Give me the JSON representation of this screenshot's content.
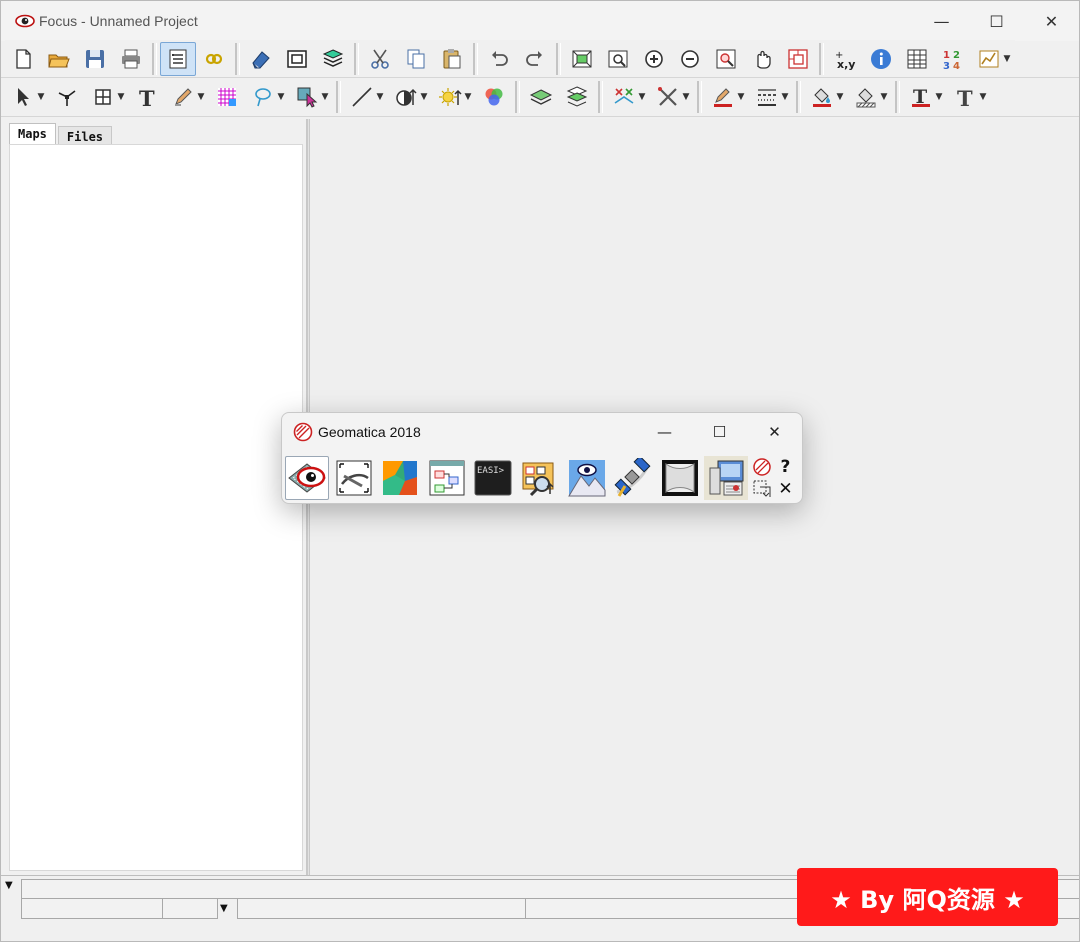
{
  "window": {
    "title": "Focus - Unnamed Project",
    "controls": {
      "minimize": "—",
      "maximize": "☐",
      "close": "✕"
    }
  },
  "toolbar1": [
    {
      "name": "new-file-icon",
      "kind": "new"
    },
    {
      "name": "open-folder-icon",
      "kind": "open"
    },
    {
      "name": "save-icon",
      "kind": "save"
    },
    {
      "name": "print-icon",
      "kind": "print"
    },
    {
      "sep": true
    },
    {
      "name": "properties-icon",
      "kind": "props",
      "pressed": true
    },
    {
      "name": "link-icon",
      "kind": "link"
    },
    {
      "sep": true
    },
    {
      "name": "eraser-icon",
      "kind": "eraser"
    },
    {
      "name": "frame-icon",
      "kind": "frame"
    },
    {
      "name": "layers-icon",
      "kind": "layers"
    },
    {
      "sep": true
    },
    {
      "name": "cut-icon",
      "kind": "cut"
    },
    {
      "name": "copy-icon",
      "kind": "copy"
    },
    {
      "name": "paste-icon",
      "kind": "paste"
    },
    {
      "sep": true
    },
    {
      "name": "undo-icon",
      "kind": "undo"
    },
    {
      "name": "redo-icon",
      "kind": "redo"
    },
    {
      "sep": true
    },
    {
      "name": "zoom-extent-icon",
      "kind": "zoomext"
    },
    {
      "name": "zoom-window-icon",
      "kind": "zoomwin"
    },
    {
      "name": "zoom-in-icon",
      "kind": "zoomin"
    },
    {
      "name": "zoom-out-icon",
      "kind": "zoomout"
    },
    {
      "name": "zoom-box-icon",
      "kind": "zoombox"
    },
    {
      "name": "pan-hand-icon",
      "kind": "pan"
    },
    {
      "name": "overview-icon",
      "kind": "overview"
    },
    {
      "sep": true
    },
    {
      "name": "xy-coordinates-icon",
      "kind": "xy"
    },
    {
      "name": "info-icon",
      "kind": "info"
    },
    {
      "name": "table-icon",
      "kind": "table"
    },
    {
      "name": "numbering-icon",
      "kind": "numbers"
    },
    {
      "name": "chart-icon",
      "kind": "chart",
      "dropdown": true
    }
  ],
  "toolbar2": [
    {
      "name": "select-arrow-icon",
      "kind": "arrow",
      "dropdown": true
    },
    {
      "name": "vertex-edit-icon",
      "kind": "vertex"
    },
    {
      "name": "grid-tool-icon",
      "kind": "grid",
      "dropdown": true
    },
    {
      "name": "text-tool-icon",
      "kind": "textT"
    },
    {
      "name": "pencil-tool-icon",
      "kind": "pencil",
      "dropdown": true
    },
    {
      "name": "raster-grid-icon",
      "kind": "raster"
    },
    {
      "name": "lasso-icon",
      "kind": "lasso",
      "dropdown": true
    },
    {
      "name": "selection-cursor-icon",
      "kind": "selcursor",
      "dropdown": true
    },
    {
      "sep": true
    },
    {
      "name": "line-tool-icon",
      "kind": "line",
      "dropdown": true
    },
    {
      "name": "contrast-icon",
      "kind": "contrast",
      "dropdown": true
    },
    {
      "name": "brightness-icon",
      "kind": "sun",
      "dropdown": true
    },
    {
      "name": "rgb-channels-icon",
      "kind": "rgb"
    },
    {
      "sep": true
    },
    {
      "name": "layer-green-icon",
      "kind": "layergreen"
    },
    {
      "name": "layer-stack-icon",
      "kind": "layerstack"
    },
    {
      "sep": true
    },
    {
      "name": "vector-symbol-icon",
      "kind": "vecsym",
      "dropdown": true
    },
    {
      "name": "tools-icon",
      "kind": "tools",
      "dropdown": true
    },
    {
      "sep": true
    },
    {
      "name": "line-color-icon",
      "kind": "linecolor",
      "dropdown": true
    },
    {
      "name": "line-style-icon",
      "kind": "linestyle",
      "dropdown": true
    },
    {
      "sep": true
    },
    {
      "name": "fill-color-icon",
      "kind": "fillcolor",
      "dropdown": true
    },
    {
      "name": "fill-style-icon",
      "kind": "fillstyle",
      "dropdown": true
    },
    {
      "sep": true
    },
    {
      "name": "text-color-icon",
      "kind": "textcolor",
      "dropdown": true
    },
    {
      "name": "text-style-icon",
      "kind": "textstyle",
      "dropdown": true
    }
  ],
  "dropdown_glyph": "▼",
  "left_panel": {
    "tabs": [
      {
        "label": "Maps",
        "active": true
      },
      {
        "label": "Files",
        "active": false
      }
    ]
  },
  "statusbar": {
    "arrow": "▼"
  },
  "geomatica": {
    "title": "Geomatica 2018",
    "controls": {
      "minimize": "—",
      "maximize": "☐",
      "close": "✕"
    },
    "icons": [
      {
        "name": "focus-eye-icon",
        "kind": "focus",
        "active": true
      },
      {
        "name": "orthoengine-icon",
        "kind": "ortho"
      },
      {
        "name": "mapping-icon",
        "kind": "mapping"
      },
      {
        "name": "modeler-icon",
        "kind": "modeler"
      },
      {
        "name": "easi-terminal-icon",
        "kind": "easi",
        "text": "EASI>"
      },
      {
        "name": "library-search-icon",
        "kind": "libsearch"
      },
      {
        "name": "mountain-eye-icon",
        "kind": "mountain"
      },
      {
        "name": "satellite-icon",
        "kind": "satellite"
      },
      {
        "name": "fly-through-icon",
        "kind": "fly"
      },
      {
        "name": "license-manager-icon",
        "kind": "license",
        "hl": true
      }
    ],
    "side": {
      "help": "?",
      "close": "✕"
    }
  },
  "watermark": "★ By 阿Q资源 ★",
  "colors": {
    "accent": "#2b6cc4",
    "watermark_bg": "#ff1a1a"
  }
}
